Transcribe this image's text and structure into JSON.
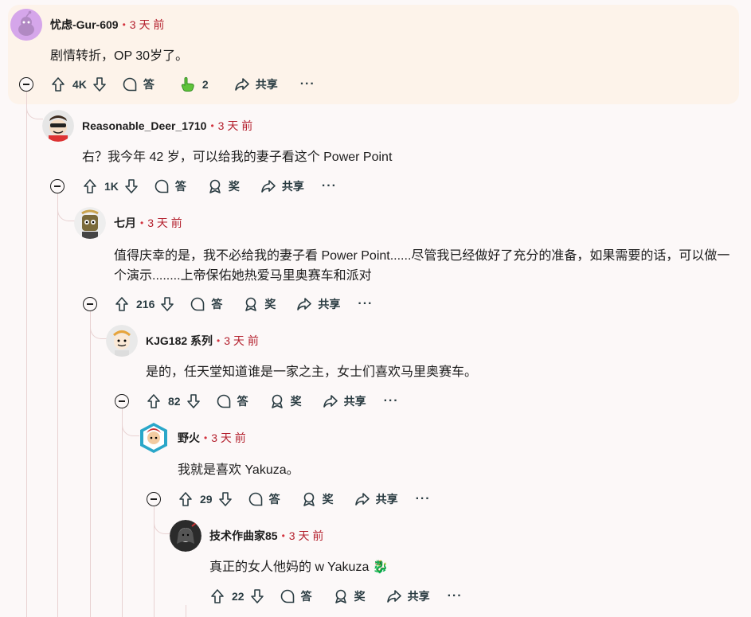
{
  "comments": [
    {
      "author": "忧虑-Gur-609",
      "time": "3 天 前",
      "text": "剧情转折，OP 30岁了。",
      "votes": "4K",
      "reply": "答",
      "award": "2",
      "share": "共享",
      "more": "···"
    },
    {
      "author": "Reasonable_Deer_1710",
      "time": "3 天 前",
      "text": "右？我今年 42 岁，可以给我的妻子看这个 Power Point",
      "votes": "1K",
      "reply": "答",
      "award": "奖",
      "share": "共享",
      "more": "···"
    },
    {
      "author": "七月",
      "time": "3 天 前",
      "text": "值得庆幸的是，我不必给我的妻子看 Power Point......尽管我已经做好了充分的准备，如果需要的话，可以做一个演示........上帝保佑她热爱马里奥赛车和派对",
      "votes": "216",
      "reply": "答",
      "award": "奖",
      "share": "共享",
      "more": "···"
    },
    {
      "author": "KJG182 系列",
      "time": "3 天 前",
      "text": "是的，任天堂知道谁是一家之主，女士们喜欢马里奥赛车。",
      "votes": "82",
      "reply": "答",
      "award": "奖",
      "share": "共享",
      "more": "···"
    },
    {
      "author": "野火",
      "time": "3 天 前",
      "text": "我就是喜欢 Yakuza。",
      "votes": "29",
      "reply": "答",
      "award": "奖",
      "share": "共享",
      "more": "···"
    },
    {
      "author": "技术作曲家85",
      "time": "3 天 前",
      "text": "真正的女人他妈的 w Yakuza 🐉",
      "votes": "22",
      "reply": "答",
      "award": "奖",
      "share": "共享",
      "more": "···"
    }
  ],
  "colors": {
    "accent": "#b4212e",
    "highlight": "#fdf3ea",
    "thread": "#e8d2d2"
  }
}
